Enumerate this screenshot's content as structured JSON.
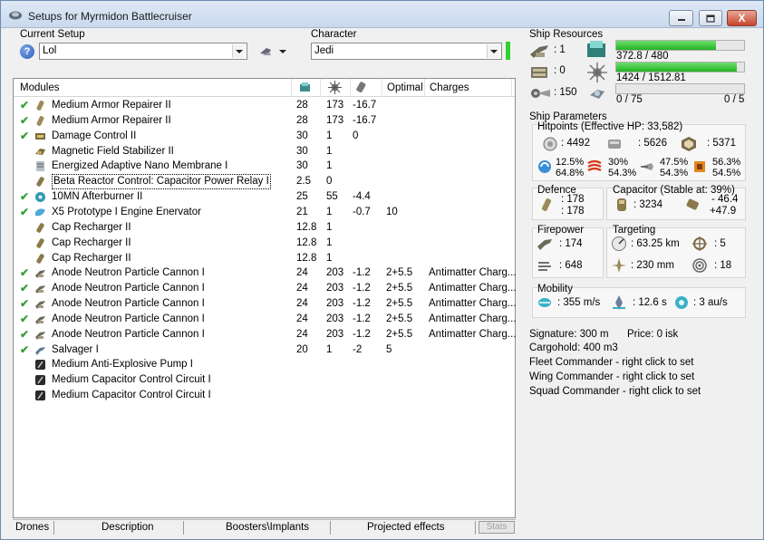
{
  "window": {
    "title": "Setups for Myrmidon Battlecruiser",
    "min_glyph": "—",
    "max_glyph": "□",
    "close_glyph": "X"
  },
  "setup": {
    "label": "Current Setup",
    "value": "Lol",
    "help_glyph": "?"
  },
  "character": {
    "label": "Character",
    "value": "Jedi",
    "status_color": "#2fd12f"
  },
  "modules": {
    "headers": [
      "Modules",
      "",
      "",
      "",
      "Optimal",
      "Charges"
    ],
    "rows": [
      {
        "checked": true,
        "icon": "armor-repairer-icon",
        "name": "Medium Armor Repairer II",
        "c1": "28",
        "c2": "173",
        "c3": "-16.7",
        "optimal": "",
        "charges": ""
      },
      {
        "checked": true,
        "icon": "armor-repairer-icon",
        "name": "Medium Armor Repairer II",
        "c1": "28",
        "c2": "173",
        "c3": "-16.7",
        "optimal": "",
        "charges": ""
      },
      {
        "checked": true,
        "icon": "damage-control-icon",
        "name": "Damage Control II",
        "c1": "30",
        "c2": "1",
        "c3": "0",
        "optimal": "",
        "charges": ""
      },
      {
        "checked": false,
        "icon": "magnetic-stabilizer-icon",
        "name": "Magnetic Field Stabilizer II",
        "c1": "30",
        "c2": "1",
        "c3": "",
        "optimal": "",
        "charges": ""
      },
      {
        "checked": false,
        "icon": "membrane-icon",
        "name": "Energized Adaptive Nano Membrane I",
        "c1": "30",
        "c2": "1",
        "c3": "",
        "optimal": "",
        "charges": ""
      },
      {
        "checked": false,
        "icon": "capacitor-relay-icon",
        "name": "Beta Reactor Control: Capacitor Power Relay I",
        "c1": "2.5",
        "c2": "0",
        "c3": "",
        "optimal": "",
        "charges": "",
        "selected": true
      },
      {
        "checked": true,
        "icon": "afterburner-icon",
        "name": "10MN Afterburner II",
        "c1": "25",
        "c2": "55",
        "c3": "-4.4",
        "optimal": "",
        "charges": ""
      },
      {
        "checked": true,
        "icon": "energy-transfer-icon",
        "name": "X5 Prototype I Engine Enervator",
        "c1": "21",
        "c2": "1",
        "c3": "-0.7",
        "optimal": "10",
        "charges": ""
      },
      {
        "checked": false,
        "icon": "cap-recharger-icon",
        "name": "Cap Recharger II",
        "c1": "12.8",
        "c2": "1",
        "c3": "",
        "optimal": "",
        "charges": ""
      },
      {
        "checked": false,
        "icon": "cap-recharger-icon",
        "name": "Cap Recharger II",
        "c1": "12.8",
        "c2": "1",
        "c3": "",
        "optimal": "",
        "charges": ""
      },
      {
        "checked": false,
        "icon": "cap-recharger-icon",
        "name": "Cap Recharger II",
        "c1": "12.8",
        "c2": "1",
        "c3": "",
        "optimal": "",
        "charges": ""
      },
      {
        "checked": true,
        "icon": "hybrid-turret-icon",
        "name": "Anode Neutron Particle Cannon I",
        "c1": "24",
        "c2": "203",
        "c3": "-1.2",
        "optimal": "2+5.5",
        "charges": "Antimatter Charg..."
      },
      {
        "checked": true,
        "icon": "hybrid-turret-icon",
        "name": "Anode Neutron Particle Cannon I",
        "c1": "24",
        "c2": "203",
        "c3": "-1.2",
        "optimal": "2+5.5",
        "charges": "Antimatter Charg..."
      },
      {
        "checked": true,
        "icon": "hybrid-turret-icon",
        "name": "Anode Neutron Particle Cannon I",
        "c1": "24",
        "c2": "203",
        "c3": "-1.2",
        "optimal": "2+5.5",
        "charges": "Antimatter Charg..."
      },
      {
        "checked": true,
        "icon": "hybrid-turret-icon",
        "name": "Anode Neutron Particle Cannon I",
        "c1": "24",
        "c2": "203",
        "c3": "-1.2",
        "optimal": "2+5.5",
        "charges": "Antimatter Charg..."
      },
      {
        "checked": true,
        "icon": "hybrid-turret-icon",
        "name": "Anode Neutron Particle Cannon I",
        "c1": "24",
        "c2": "203",
        "c3": "-1.2",
        "optimal": "2+5.5",
        "charges": "Antimatter Charg..."
      },
      {
        "checked": true,
        "icon": "salvager-icon",
        "name": "Salvager I",
        "c1": "20",
        "c2": "1",
        "c3": "-2",
        "optimal": "5",
        "charges": ""
      },
      {
        "checked": false,
        "icon": "rig-icon",
        "name": "Medium Anti-Explosive Pump I",
        "c1": "",
        "c2": "",
        "c3": "",
        "optimal": "",
        "charges": ""
      },
      {
        "checked": false,
        "icon": "rig-icon",
        "name": "Medium Capacitor Control Circuit I",
        "c1": "",
        "c2": "",
        "c3": "",
        "optimal": "",
        "charges": ""
      },
      {
        "checked": false,
        "icon": "rig-icon",
        "name": "Medium Capacitor Control Circuit I",
        "c1": "",
        "c2": "",
        "c3": "",
        "optimal": "",
        "charges": ""
      }
    ],
    "check_glyph": "✔"
  },
  "bottom_tabs": {
    "drones": "Drones",
    "description": "Description",
    "boosters": "Boosters\\Implants",
    "projected": "Projected effects",
    "stats": "Stats"
  },
  "resources": {
    "title": "Ship Resources",
    "turret_hardpoints": ": 1",
    "launcher_hardpoints": ": 0",
    "calibration": ": 150",
    "cpu_text": "372.8 / 480",
    "cpu_fraction": 0.777,
    "power_text": "1424 / 1512.81",
    "power_fraction": 0.941,
    "drone_bay_text": "0 / 75",
    "drone_bay_fraction": 0.0,
    "drones_text": "0 / 5"
  },
  "parameters": {
    "title": "Ship Parameters",
    "hitpoints_title": "Hitpoints (Effective HP: 33,582)",
    "shield_hp": ": 4492",
    "armor_hp": ": 5626",
    "structure_hp": ": 5371",
    "res_em": [
      "12.5%",
      "64.8%"
    ],
    "res_thermal": [
      "30%",
      "54.3%"
    ],
    "res_kinetic": [
      "47.5%",
      "54.3%"
    ],
    "res_explosive": [
      "56.3%",
      "54.5%"
    ],
    "defence_title": "Defence",
    "defence_1": ": 178",
    "defence_2": ": 178",
    "capacitor_title": "Capacitor (Stable at: 39%)",
    "capacitor_amount": ": 3234",
    "capacitor_delta_1": "- 46.4",
    "capacitor_delta_2": "+47.9",
    "firepower_title": "Firepower",
    "firepower_1": ": 174",
    "firepower_2": ": 648",
    "targeting_title": "Targeting",
    "target_range": ": 63.25 km",
    "max_targets": ": 5",
    "scan_resolution": ": 230 mm",
    "sensor_strength": ": 18",
    "mobility_title": "Mobility",
    "speed": ": 355 m/s",
    "align_time": ": 12.6 s",
    "warp_speed": ": 3 au/s",
    "signature": "Signature: 300 m",
    "price": "Price: 0 isk",
    "cargohold": "Cargohold: 400 m3",
    "fleet_commander": "Fleet Commander - right click to set",
    "wing_commander": "Wing Commander - right click to set",
    "squad_commander": "Squad Commander - right click to set"
  }
}
